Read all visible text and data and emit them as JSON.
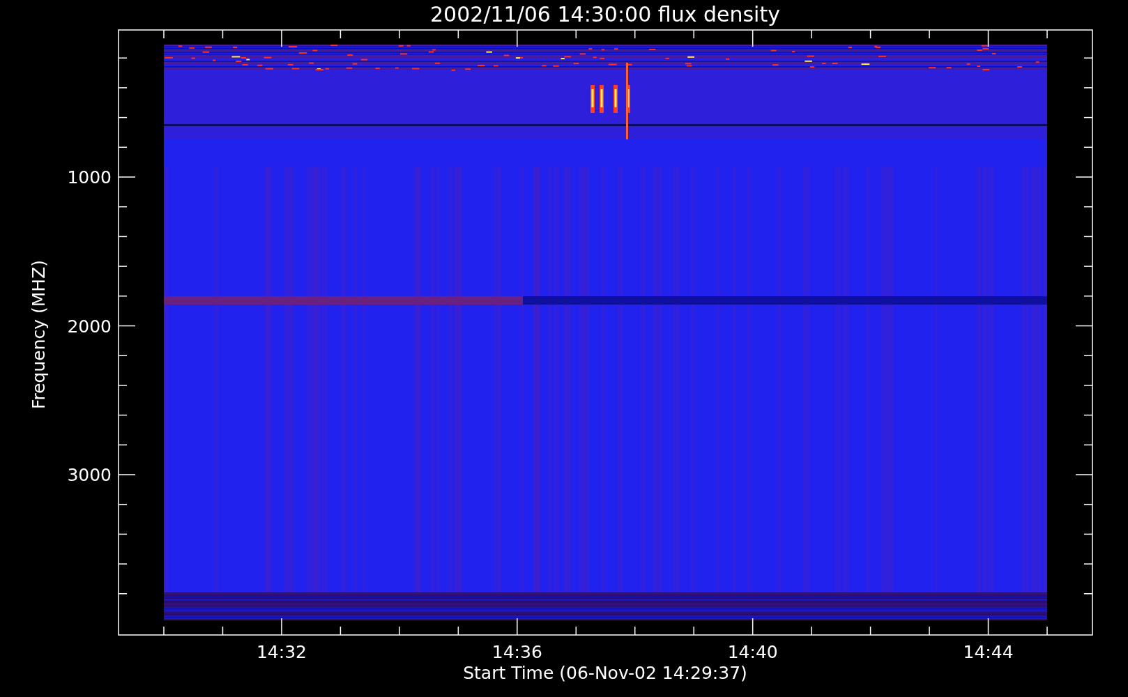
{
  "title": "2002/11/06 14:30:00 flux density",
  "ylabel": "Frequency (MHZ)",
  "yticks": [
    "1000",
    "2000",
    "3000"
  ],
  "xticks": [
    "14:32",
    "14:36",
    "14:40",
    "14:44"
  ],
  "xlabel": "Start Time (06-Nov-02 14:29:37)"
}
